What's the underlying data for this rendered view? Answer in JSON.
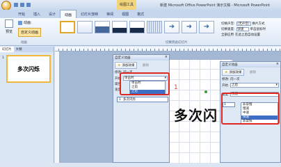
{
  "titlebar": {
    "tool_context": "绘图工具",
    "title": "新建 Microsoft Office PowerPoint 演示文稿 - Microsoft PowerPoint"
  },
  "tabs": [
    "开始",
    "插入",
    "设计",
    "动画",
    "幻灯片放映",
    "审阅",
    "视图",
    "格式"
  ],
  "ribbon": {
    "preview_label": "预览",
    "animation_label": "动画:",
    "custom_animation_label": "自定义动画",
    "group_animation": "动画",
    "group_transition": "切换到此幻灯片",
    "transition_sound_label": "切换声音:",
    "transition_sound_value": "[无声音]",
    "transition_speed_label": "切换速度:",
    "transition_speed_value": "快速",
    "apply_all_label": "全部应用",
    "advance_label": "换片方式",
    "on_click_label": "单击鼠标时",
    "after_label": "在此之后自动设置"
  },
  "left_panel": {
    "tab_slides": "幻灯片",
    "tab_outline": "大纲",
    "slide_number": "1",
    "slide_title": "多次闪烁"
  },
  "slide": {
    "title_text": "多次闪",
    "anim_number": "1"
  },
  "pane1": {
    "title": "自定义动画",
    "add_effect": "添加效果",
    "remove": "删除",
    "modify_label": "修改: 闪一次",
    "start_label": "开始",
    "start_value": "单击时",
    "property_label": "属性",
    "speed_label": "速度",
    "start_options": [
      "单击时",
      "之前",
      "之后"
    ],
    "timeline_item": {
      "number": "1",
      "text": "多次闪烁"
    }
  },
  "pane2": {
    "title": "自定义动画",
    "add_effect": "添加效果",
    "remove": "删除",
    "modify_label": "修改: 闪一次",
    "start_label": "开始",
    "start_value": "之后",
    "speed_label": "速度",
    "speed_value": "快速",
    "speed_options": [
      "非常慢",
      "慢速",
      "中速",
      "快速",
      "非常快"
    ],
    "timeline_item": "1"
  },
  "colors": {
    "highlight_red": "#e0271d",
    "selection_blue": "#3e6fc4",
    "ribbon_accent": "#f0b73a"
  }
}
